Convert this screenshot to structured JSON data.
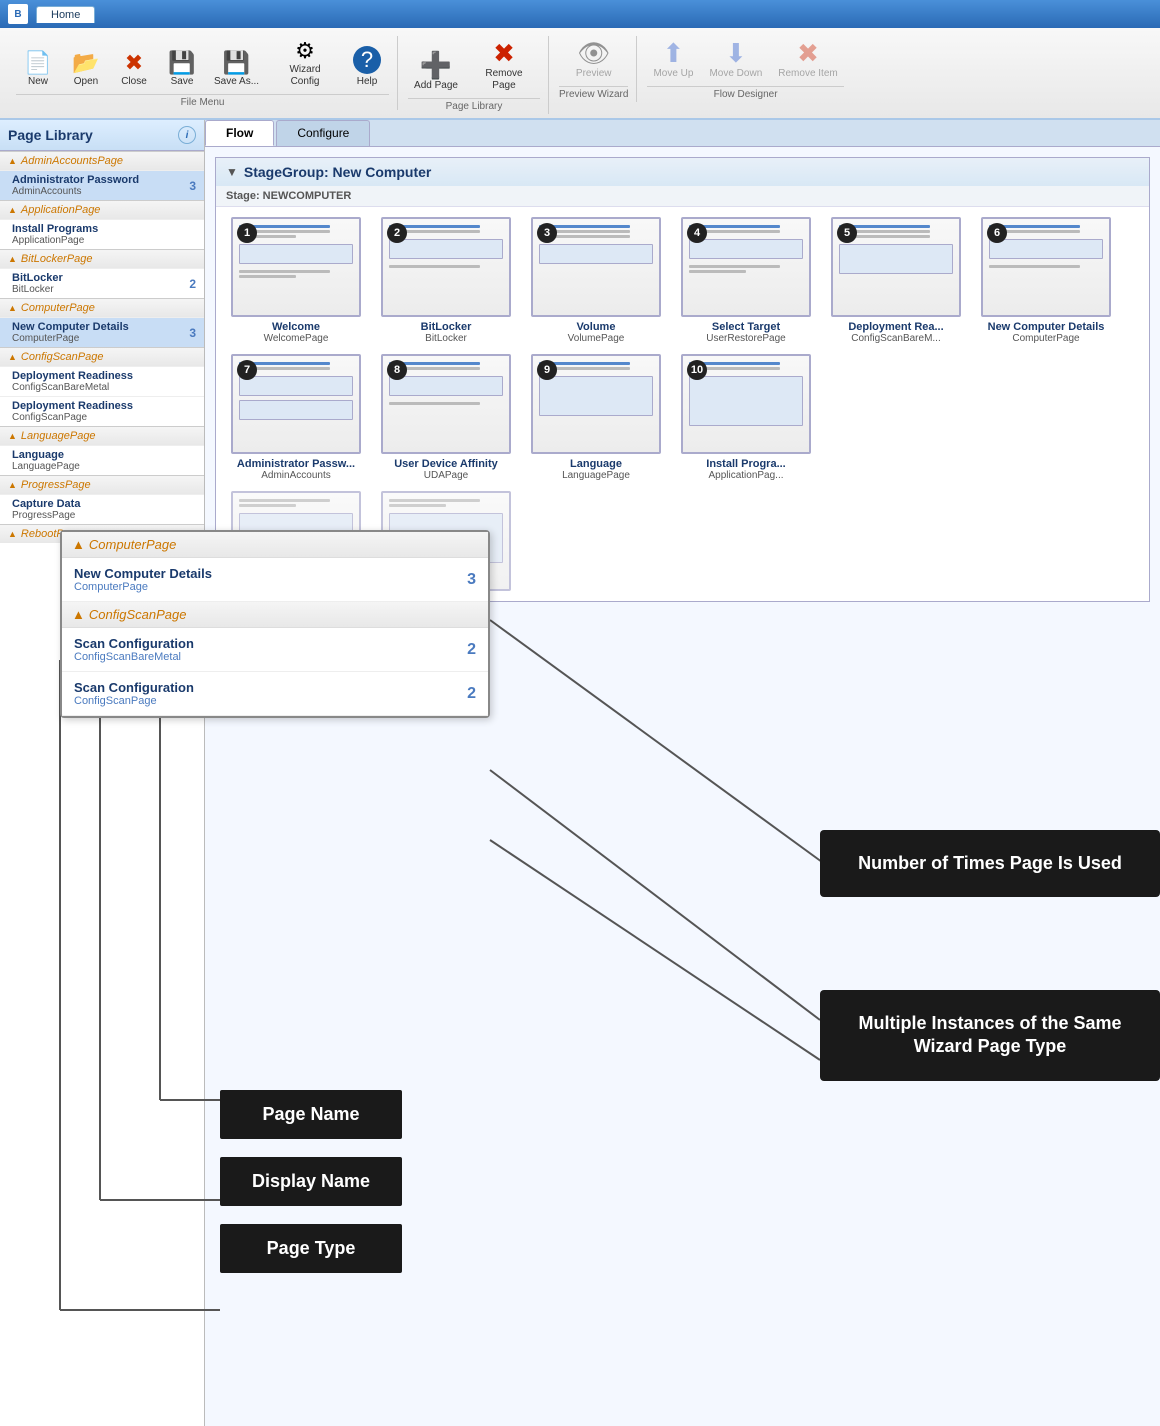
{
  "titlebar": {
    "icon": "B",
    "tabs": [
      "Home"
    ]
  },
  "ribbon": {
    "groups": [
      {
        "label": "File Menu",
        "items": [
          {
            "id": "new",
            "label": "New",
            "icon": "📄",
            "disabled": false
          },
          {
            "id": "open",
            "label": "Open",
            "icon": "📂",
            "disabled": false
          },
          {
            "id": "close",
            "label": "Close",
            "icon": "✖",
            "disabled": false
          },
          {
            "id": "save",
            "label": "Save",
            "icon": "💾",
            "disabled": false
          },
          {
            "id": "save-as",
            "label": "Save As...",
            "icon": "💾",
            "disabled": false
          },
          {
            "id": "wizard-config",
            "label": "Wizard Config",
            "icon": "⚙",
            "disabled": false
          },
          {
            "id": "help",
            "label": "Help",
            "icon": "❓",
            "disabled": false
          }
        ]
      },
      {
        "label": "Page Library",
        "items": [
          {
            "id": "add-page",
            "label": "Add Page",
            "icon": "➕",
            "disabled": false
          },
          {
            "id": "remove-page",
            "label": "Remove Page",
            "icon": "✖",
            "disabled": false
          }
        ]
      },
      {
        "label": "Preview Wizard",
        "items": [
          {
            "id": "preview",
            "label": "Preview",
            "icon": "👁",
            "disabled": true
          }
        ]
      },
      {
        "label": "Flow Designer",
        "items": [
          {
            "id": "move-up",
            "label": "Move Up",
            "icon": "⬆",
            "disabled": true
          },
          {
            "id": "move-down",
            "label": "Move Down",
            "icon": "⬇",
            "disabled": true
          },
          {
            "id": "remove-item",
            "label": "Remove Item",
            "icon": "✖",
            "disabled": true
          }
        ]
      }
    ]
  },
  "sidebar": {
    "title": "Page Library",
    "groups": [
      {
        "name": "AdminAccountsPage",
        "items": [
          {
            "display": "Administrator Password",
            "type": "AdminAccounts",
            "count": "3",
            "selected": false
          }
        ]
      },
      {
        "name": "ApplicationPage",
        "items": [
          {
            "display": "Install Programs",
            "type": "ApplicationPage",
            "count": "",
            "selected": false
          }
        ]
      },
      {
        "name": "BitLockerPage",
        "items": [
          {
            "display": "BitLocker",
            "type": "BitLocker",
            "count": "2",
            "selected": false
          }
        ]
      },
      {
        "name": "ComputerPage",
        "items": [
          {
            "display": "New Computer Details",
            "type": "ComputerPage",
            "count": "3",
            "selected": true
          }
        ]
      },
      {
        "name": "ConfigScanPage",
        "items": [
          {
            "display": "Deployment Readiness",
            "type": "ConfigScanBareMetal",
            "count": "",
            "selected": false
          },
          {
            "display": "Deployment Readiness",
            "type": "ConfigScanPage",
            "count": "",
            "selected": false
          }
        ]
      },
      {
        "name": "LanguagePage",
        "items": [
          {
            "display": "Language",
            "type": "LanguagePage",
            "count": "",
            "selected": false
          }
        ]
      },
      {
        "name": "ProgressPage",
        "items": [
          {
            "display": "Capture Data",
            "type": "ProgressPage",
            "count": "",
            "selected": false
          }
        ]
      },
      {
        "name": "RebootPage",
        "items": []
      }
    ]
  },
  "content": {
    "tabs": [
      "Flow",
      "Configure"
    ],
    "active_tab": "Flow",
    "stage_group_title": "StageGroup: New Computer",
    "stage_name": "Stage: NEWCOMPUTER",
    "pages": [
      {
        "num": 1,
        "name": "Welcome",
        "type": "WelcomePage"
      },
      {
        "num": 2,
        "name": "BitLocker",
        "type": "BitLocker"
      },
      {
        "num": 3,
        "name": "Volume",
        "type": "VolumePage"
      },
      {
        "num": 4,
        "name": "Select Target",
        "type": "UserRestorePage"
      },
      {
        "num": 5,
        "name": "Deployment Rea...",
        "type": "ConfigScanBareM..."
      },
      {
        "num": 6,
        "name": "New Computer Details",
        "type": "ComputerPage"
      },
      {
        "num": 7,
        "name": "Administrator Passw...",
        "type": "AdminAccounts"
      },
      {
        "num": 8,
        "name": "User Device Affinity",
        "type": "UDAPage"
      },
      {
        "num": 9,
        "name": "Language",
        "type": "LanguagePage"
      },
      {
        "num": 10,
        "name": "Install Progra...",
        "type": "ApplicationPag..."
      }
    ]
  },
  "zoomed_panel": {
    "groups": [
      {
        "header": "ComputerPage",
        "items": [
          {
            "display": "New Computer Details",
            "type": "ComputerPage",
            "count": "3"
          }
        ]
      },
      {
        "header": "ConfigScanPage",
        "items": [
          {
            "display": "Scan Configuration",
            "type": "ConfigScanBareMetal",
            "count": "2"
          },
          {
            "display": "Scan Configuration",
            "type": "ConfigScanPage",
            "count": "2"
          }
        ]
      }
    ]
  },
  "callouts": {
    "number_of_times": "Number of Times Page Is Used",
    "multiple_instances": "Multiple Instances of the Same Wizard Page Type"
  },
  "label_boxes": {
    "page_name": "Page Name",
    "display_name": "Display Name",
    "page_type": "Page Type"
  }
}
